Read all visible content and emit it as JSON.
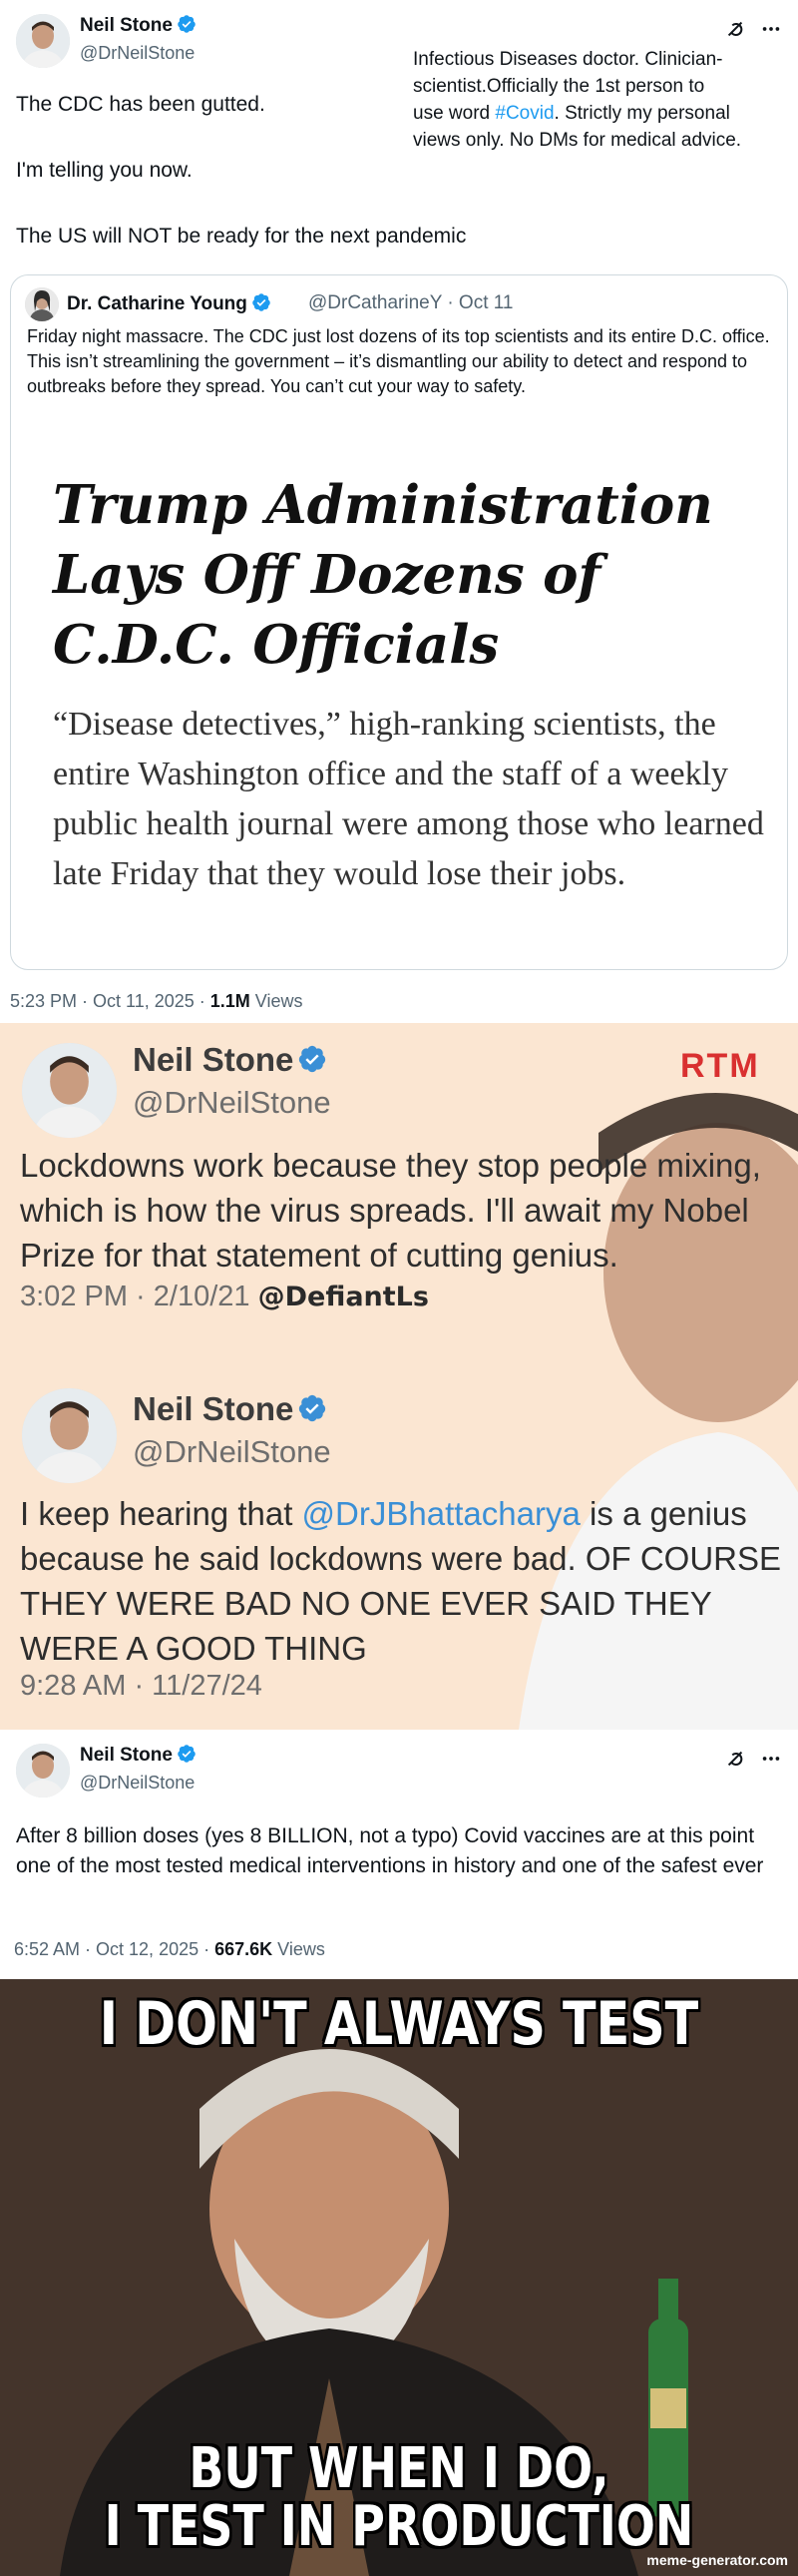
{
  "tweet1": {
    "author_name": "Neil Stone",
    "author_handle": "@DrNeilStone",
    "bio_lines": [
      "Infectious Diseases doctor. Clinician-",
      "scientist.Officially the 1st person to",
      "use word "
    ],
    "bio_link": "#Covid",
    "bio_tail": ". Strictly my personal",
    "bio_last": "views only. No DMs for medical advice.",
    "text_1": "The CDC has been gutted.",
    "text_2": "I'm telling you now.",
    "text_3": "The US will NOT be ready for the next pandemic",
    "timestamp": "5:23 PM · Oct 11, 2025 · ",
    "views_count": "1.1M",
    "views_label": " Views"
  },
  "quote": {
    "author_name": "Dr. Catharine Young",
    "author_handle": "@DrCatharineY · Oct 11",
    "text": "Friday night massacre. The CDC just lost dozens of its top scientists and its entire D.C. office. This isn’t streamlining the government – it’s dismantling our ability to detect and respond to outbreaks before they spread. You can’t cut your way to safety.",
    "headline": "Trump Administration Lays Off Dozens of C.D.C. Officials",
    "summary": "“Disease detectives,” high-ranking scientists, the entire Washington office and the staff of a weekly public health journal were among those who learned late Friday that they would lose their jobs."
  },
  "screenshot": {
    "brand": "RTM",
    "post1_name": "Neil Stone",
    "post1_handle": "@DrNeilStone",
    "post1_text": "Lockdowns work because they stop people mixing, which is how the virus spreads. I'll await my Nobel Prize for that statement of cutting genius.",
    "post1_time": "3:02 PM · 2/10/21",
    "post1_tag": "@DefiantLs",
    "post2_name": "Neil Stone",
    "post2_handle": "@DrNeilStone",
    "post2_text_a": "I keep hearing that ",
    "post2_link": "@DrJBhattacharya",
    "post2_text_b": " is a genius because he said lockdowns were bad. OF COURSE THEY WERE BAD NO ONE EVER SAID THEY WERE A GOOD THING",
    "post2_time": "9:28 AM · 11/27/24"
  },
  "tweet2": {
    "author_name": "Neil Stone",
    "author_handle": "@DrNeilStone",
    "text": "After 8 billion doses (yes 8 BILLION, not a typo) Covid vaccines are at this point one of the most tested medical interventions in history and one of the safest ever",
    "timestamp": "6:52 AM · Oct 12, 2025 · ",
    "views_count": "667.6K",
    "views_label": " Views"
  },
  "meme": {
    "top_text": "I DON'T ALWAYS TEST",
    "bottom_line1": "BUT WHEN I DO,",
    "bottom_line2": "I TEST IN PRODUCTION",
    "watermark": "meme-generator.com"
  },
  "colors": {
    "accent": "#1d9bf0",
    "secondary_text": "#536471",
    "border": "#cfd9de"
  }
}
